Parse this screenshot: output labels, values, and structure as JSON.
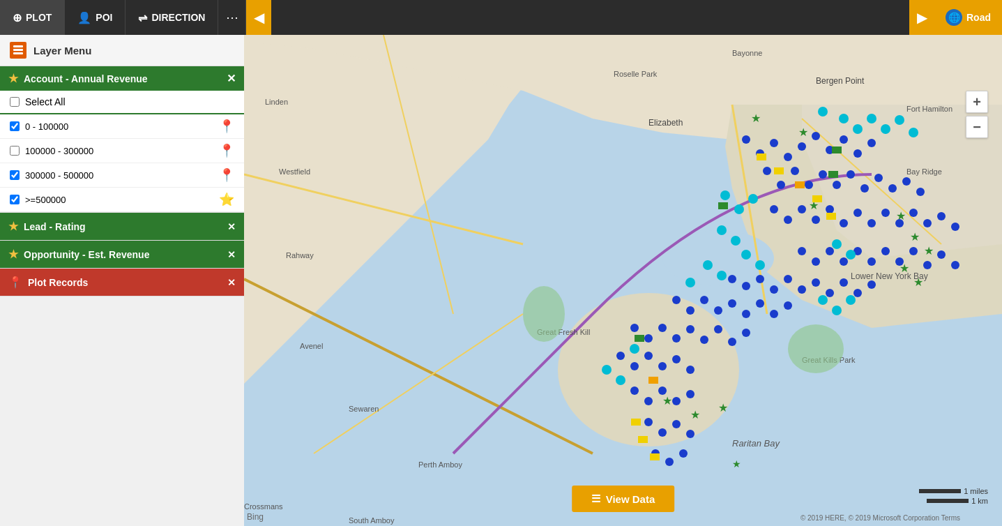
{
  "toolbar": {
    "plot_label": "PLOT",
    "poi_label": "POI",
    "direction_label": "DIRECTION",
    "more_icon": "⋯",
    "collapse_icon": "◀",
    "expand_icon": "▶",
    "road_label": "Road",
    "globe_char": "🌐"
  },
  "layer_menu": {
    "title": "Layer Menu"
  },
  "account_section": {
    "title": "Account - Annual Revenue",
    "select_all_label": "Select All",
    "rows": [
      {
        "label": "0 - 100000",
        "checked": true,
        "pin_color": "cyan",
        "pin_char": "📍"
      },
      {
        "label": "100000 - 300000",
        "checked": false,
        "pin_color": "pink",
        "pin_char": "📍"
      },
      {
        "label": "300000 - 500000",
        "checked": true,
        "pin_color": "blue",
        "pin_char": "📍"
      },
      {
        "label": ">=500000",
        "checked": true,
        "pin_color": "green",
        "pin_char": "📍"
      }
    ]
  },
  "lead_rating": {
    "title": "Lead - Rating"
  },
  "opportunity": {
    "title": "Opportunity - Est. Revenue"
  },
  "plot_records": {
    "title": "Plot Records"
  },
  "view_data_button": "View Data",
  "map": {
    "copyright": "© 2019 HERE, © 2019 Microsoft Corporation Terms",
    "bing": "Bing",
    "scale_miles": "1 miles",
    "scale_km": "1 km"
  },
  "zoom": {
    "plus": "+",
    "minus": "−"
  }
}
